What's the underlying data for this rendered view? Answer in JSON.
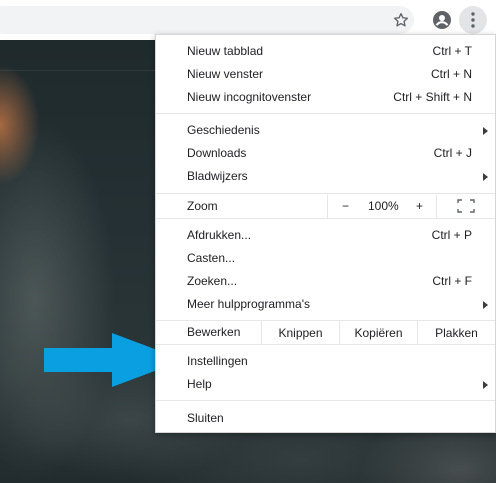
{
  "toolbar": {
    "icons": [
      "star-icon",
      "account-icon",
      "kebab-menu-icon"
    ]
  },
  "colors": {
    "arrow": "#0a9fe0",
    "menu_background": "#ffffff",
    "separator": "#e6e6e6",
    "toolbar_button_active": "#e3e4e6"
  },
  "menu": {
    "new_tab": {
      "label": "Nieuw tabblad",
      "shortcut": "Ctrl + T"
    },
    "new_window": {
      "label": "Nieuw venster",
      "shortcut": "Ctrl + N"
    },
    "new_incognito": {
      "label": "Nieuw incognitovenster",
      "shortcut": "Ctrl + Shift + N"
    },
    "history": {
      "label": "Geschiedenis"
    },
    "downloads": {
      "label": "Downloads",
      "shortcut": "Ctrl + J"
    },
    "bookmarks": {
      "label": "Bladwijzers"
    },
    "zoom": {
      "label": "Zoom",
      "minus": "−",
      "value": "100%",
      "plus": "+"
    },
    "print": {
      "label": "Afdrukken...",
      "shortcut": "Ctrl + P"
    },
    "cast": {
      "label": "Casten..."
    },
    "find": {
      "label": "Zoeken...",
      "shortcut": "Ctrl + F"
    },
    "more_tools": {
      "label": "Meer hulpprogramma's"
    },
    "edit": {
      "label": "Bewerken",
      "cut": "Knippen",
      "copy": "Kopiëren",
      "paste": "Plakken"
    },
    "settings": {
      "label": "Instellingen"
    },
    "help": {
      "label": "Help"
    },
    "exit": {
      "label": "Sluiten"
    }
  }
}
